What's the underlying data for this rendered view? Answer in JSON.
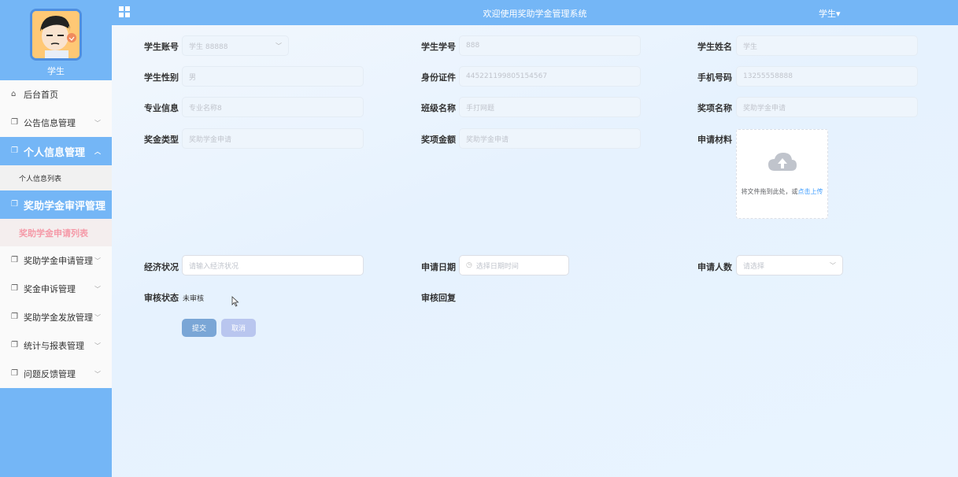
{
  "sidebar": {
    "user_label": "学生",
    "menu": [
      {
        "label": "后台首页",
        "icon": "home-icon",
        "expandable": false
      },
      {
        "label": "公告信息管理",
        "icon": "doc-icon",
        "expandable": true
      },
      {
        "label": "个人信息管理",
        "icon": "doc-icon",
        "expandable": true,
        "active": true
      },
      {
        "label": "个人信息列表",
        "submenu": true
      },
      {
        "label": "奖助学金审评管理",
        "icon": "doc-icon",
        "active": true
      },
      {
        "label": "奖助学金申请列表",
        "submenu": true,
        "selected": true
      },
      {
        "label": "奖助学金申请管理",
        "icon": "doc-icon",
        "expandable": true
      },
      {
        "label": "奖金申诉管理",
        "icon": "doc-icon",
        "expandable": true
      },
      {
        "label": "奖助学金发放管理",
        "icon": "doc-icon",
        "expandable": true
      },
      {
        "label": "统计与报表管理",
        "icon": "doc-icon",
        "expandable": true
      },
      {
        "label": "问题反馈管理",
        "icon": "doc-icon",
        "expandable": true
      }
    ]
  },
  "header": {
    "title": "欢迎使用奖助学金管理系统",
    "user": "学生▾"
  },
  "form": {
    "student_account": {
      "label": "学生账号",
      "value": "学生 88888"
    },
    "student_id": {
      "label": "学生学号",
      "value": "888"
    },
    "student_name": {
      "label": "学生姓名",
      "value": "学生"
    },
    "gender": {
      "label": "学生性别",
      "value": "男"
    },
    "id_card": {
      "label": "身份证件",
      "value": "445221199805154567"
    },
    "phone": {
      "label": "手机号码",
      "value": "13255558888"
    },
    "major": {
      "label": "专业信息",
      "value": "专业名称8"
    },
    "class_name": {
      "label": "班级名称",
      "value": "手打网题"
    },
    "award_name": {
      "label": "奖项名称",
      "value": "奖助学金申请"
    },
    "award_type": {
      "label": "奖金类型",
      "value": "奖助学金申请"
    },
    "award_amount": {
      "label": "奖项金额",
      "value": "奖助学金申请"
    },
    "materials": {
      "label": "申请材料",
      "upload_text": "将文件拖到此处，或",
      "upload_link": "点击上传"
    },
    "economy": {
      "label": "经济状况",
      "placeholder": "请输入经济状况"
    },
    "apply_date": {
      "label": "申请日期",
      "placeholder": "选择日期时间"
    },
    "applicants": {
      "label": "申请人数",
      "placeholder": "请选择"
    },
    "review_status": {
      "label": "审核状态",
      "value": "未审核"
    },
    "review_reply": {
      "label": "审核回复"
    },
    "submit": "提交",
    "cancel": "取消"
  },
  "colors": {
    "primary": "#74b6f6",
    "selected_text": "#f59aa8",
    "link": "#409eff"
  }
}
